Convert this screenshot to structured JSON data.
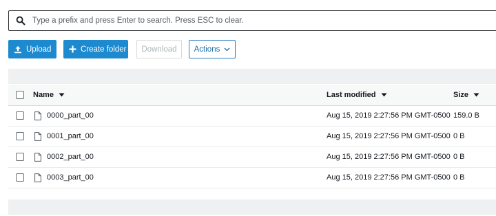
{
  "search": {
    "placeholder": "Type a prefix and press Enter to search. Press ESC to clear.",
    "icon": "search-icon"
  },
  "toolbar": {
    "upload_label": "Upload",
    "create_folder_label": "Create folder",
    "download_label": "Download",
    "actions_label": "Actions"
  },
  "colors": {
    "primary": "#1d8ad0",
    "disabled_text": "#aab7b8",
    "actions_border": "#2b7fbf",
    "band": "#eef0f1"
  },
  "table": {
    "headers": {
      "name": "Name",
      "last_modified": "Last modified",
      "size": "Size"
    },
    "rows": [
      {
        "name": "0000_part_00",
        "last_modified": "Aug 15, 2019 2:27:56 PM GMT-0500",
        "size": "159.0 B"
      },
      {
        "name": "0001_part_00",
        "last_modified": "Aug 15, 2019 2:27:56 PM GMT-0500",
        "size": "0 B"
      },
      {
        "name": "0002_part_00",
        "last_modified": "Aug 15, 2019 2:27:56 PM GMT-0500",
        "size": "0 B"
      },
      {
        "name": "0003_part_00",
        "last_modified": "Aug 15, 2019 2:27:56 PM GMT-0500",
        "size": "0 B"
      }
    ]
  }
}
